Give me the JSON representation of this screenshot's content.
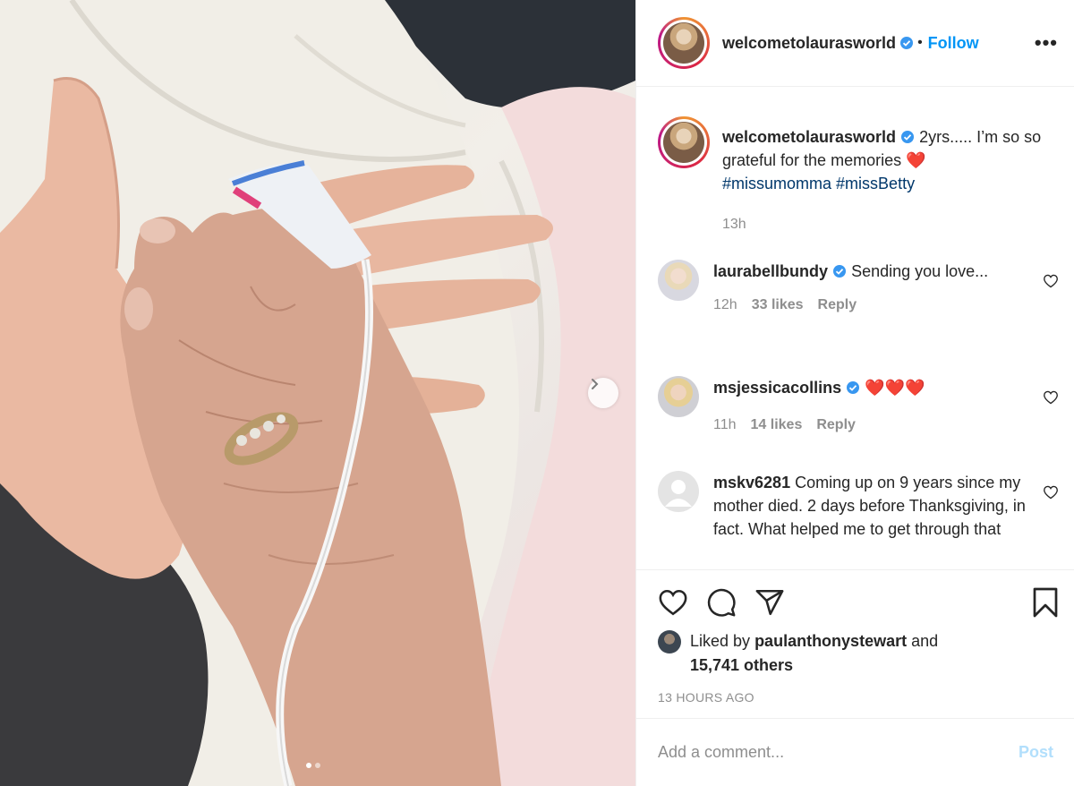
{
  "post": {
    "username": "welcometolaurasworld",
    "follow_label": "Follow",
    "separator": "•",
    "more_label": "•••"
  },
  "caption": {
    "username": "welcometolaurasworld",
    "text": "2yrs..... I’m so so grateful for the memories ❤️",
    "tags": [
      "#missumomma",
      "#missBetty"
    ],
    "time": "13h"
  },
  "comments": [
    {
      "username": "laurabellbundy",
      "text": "Sending you love...",
      "time": "12h",
      "likes": "33 likes",
      "reply": "Reply"
    },
    {
      "username": "msjessicacollins",
      "text": "❤️❤️❤️",
      "time": "11h",
      "likes": "14 likes",
      "reply": "Reply"
    },
    {
      "username": "mskv6281",
      "text": "Coming up on 9 years since my mother died. 2 days before Thanksgiving, in fact. What helped me to get through that"
    }
  ],
  "likes": {
    "prefix": "Liked by",
    "user": "paulanthonystewart",
    "joiner": "and",
    "others": "15,741 others"
  },
  "timestamp": "13 HOURS AGO",
  "add_comment": {
    "placeholder": "Add a comment...",
    "post_label": "Post"
  },
  "carousel": {
    "slides": 2,
    "current": 1
  },
  "colors": {
    "accent": "#0095f6",
    "verified": "#3897f0",
    "tag": "#00376b",
    "muted": "#8e8e8e",
    "post_disabled": "#b2dffc"
  }
}
